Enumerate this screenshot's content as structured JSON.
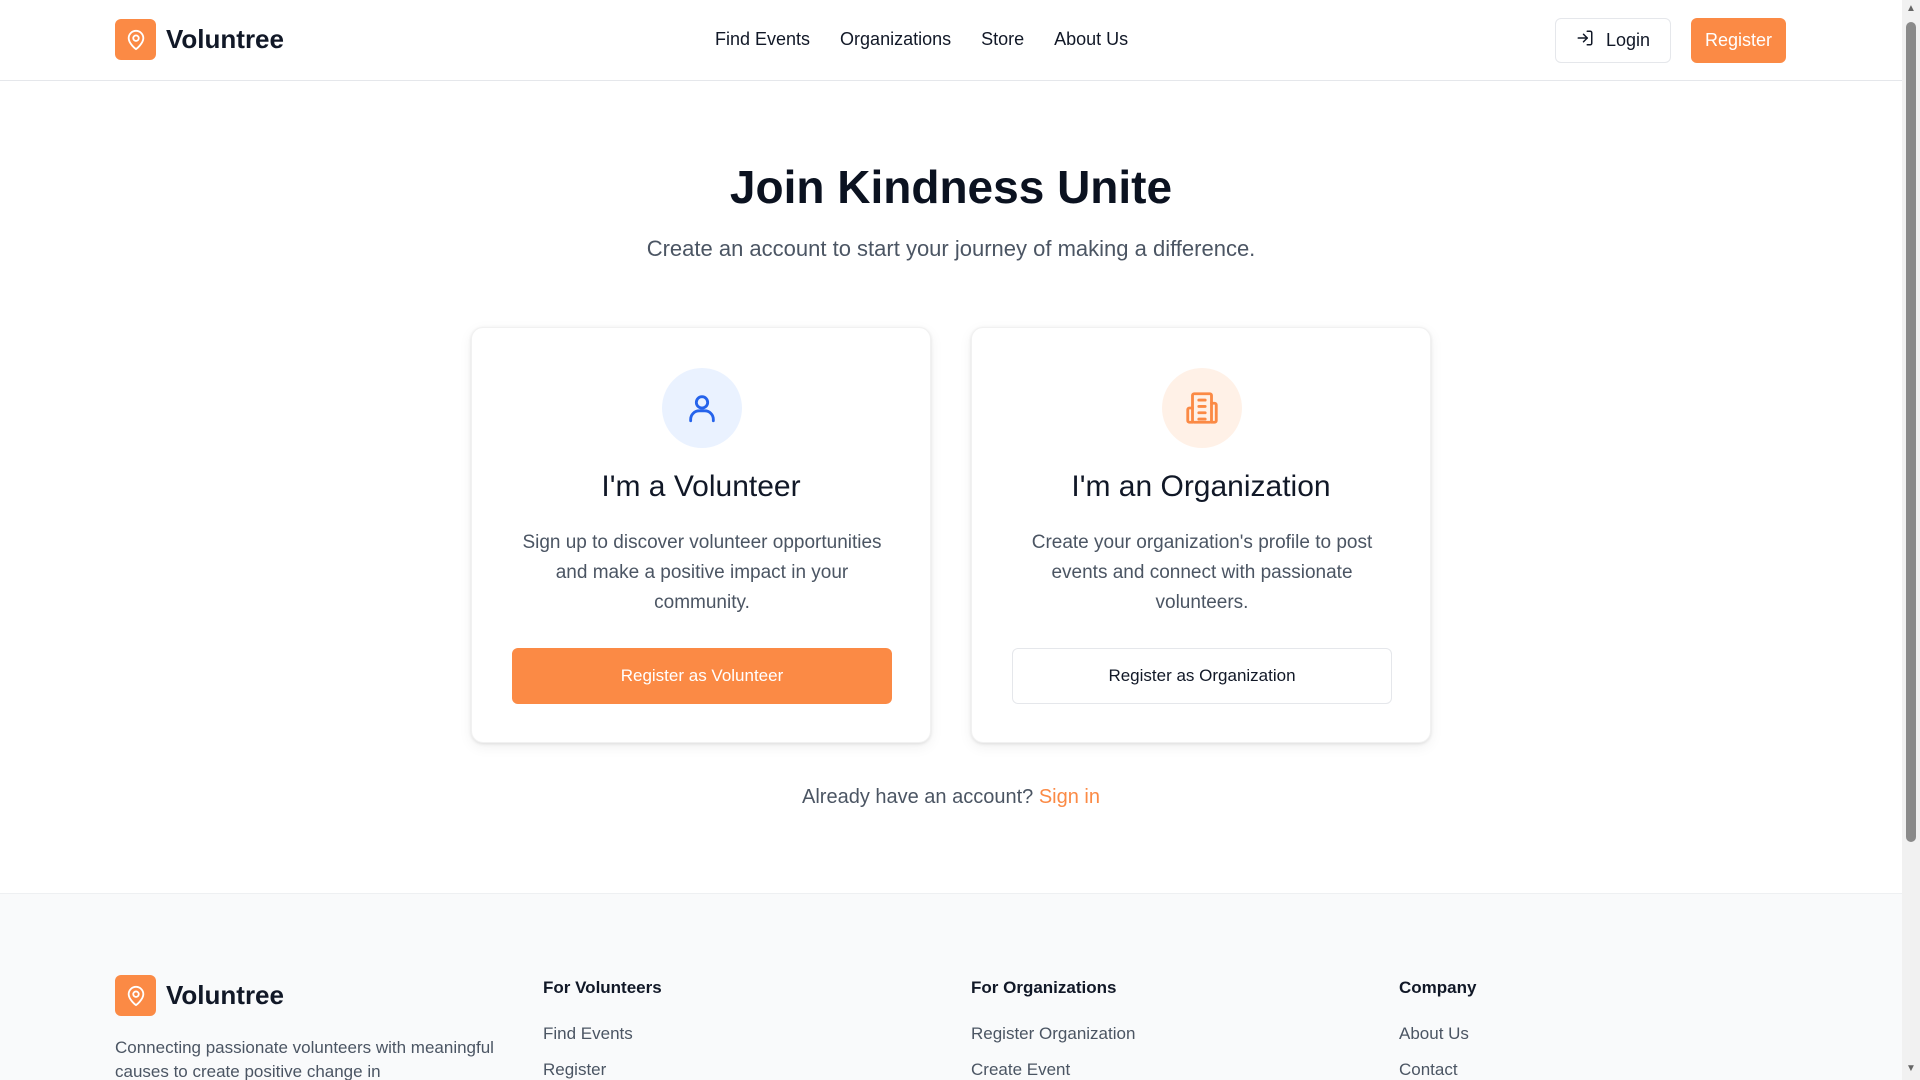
{
  "brand": {
    "name": "Voluntree",
    "color": "#fb8a45"
  },
  "nav": {
    "items": [
      "Find Events",
      "Organizations",
      "Store",
      "About Us"
    ]
  },
  "header": {
    "login_label": "Login",
    "register_label": "Register"
  },
  "hero": {
    "title": "Join Kindness Unite",
    "subtitle": "Create an account to start your journey of making a difference."
  },
  "cards": {
    "volunteer": {
      "icon": "user-icon",
      "title": "I'm a Volunteer",
      "description": "Sign up to discover volunteer opportunities and make a positive impact in your community.",
      "button": "Register as Volunteer"
    },
    "organization": {
      "icon": "building-icon",
      "title": "I'm an Organization",
      "description": "Create your organization's profile to post events and connect with passionate volunteers.",
      "button": "Register as Organization"
    }
  },
  "signin": {
    "prompt": "Already have an account?",
    "link": "Sign in"
  },
  "footer": {
    "tagline": "Connecting passionate volunteers with meaningful causes to create positive change in",
    "columns": [
      {
        "heading": "For Volunteers",
        "links": [
          "Find Events",
          "Register"
        ]
      },
      {
        "heading": "For Organizations",
        "links": [
          "Register Organization",
          "Create Event"
        ]
      },
      {
        "heading": "Company",
        "links": [
          "About Us",
          "Contact"
        ]
      }
    ]
  }
}
